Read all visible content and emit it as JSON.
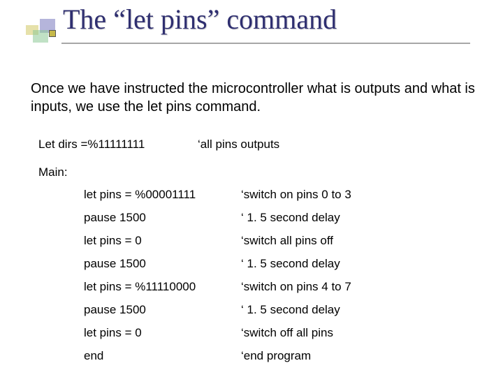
{
  "title": "The “let pins” command",
  "intro": "Once we have instructed the microcontroller what is outputs and what is inputs, we use the let pins command.",
  "line1": {
    "cmd": "Let dirs =%11111111",
    "comment": "‘all pins outputs"
  },
  "main_label": "Main:",
  "code": [
    {
      "cmd": "let pins = %00001111",
      "comment": "‘switch on pins 0 to 3"
    },
    {
      "cmd": "pause 1500",
      "comment": "‘ 1. 5 second delay"
    },
    {
      "cmd": "let pins = 0",
      "comment": "‘switch all pins off"
    },
    {
      "cmd": "pause 1500",
      "comment": "‘ 1. 5 second delay"
    },
    {
      "cmd": "let pins = %11110000",
      "comment": "‘switch on pins 4 to 7"
    },
    {
      "cmd": "pause 1500",
      "comment": "‘ 1. 5 second delay"
    },
    {
      "cmd": "let pins = 0",
      "comment": "‘switch off all pins"
    },
    {
      "cmd": "end",
      "comment": "‘end program"
    }
  ]
}
